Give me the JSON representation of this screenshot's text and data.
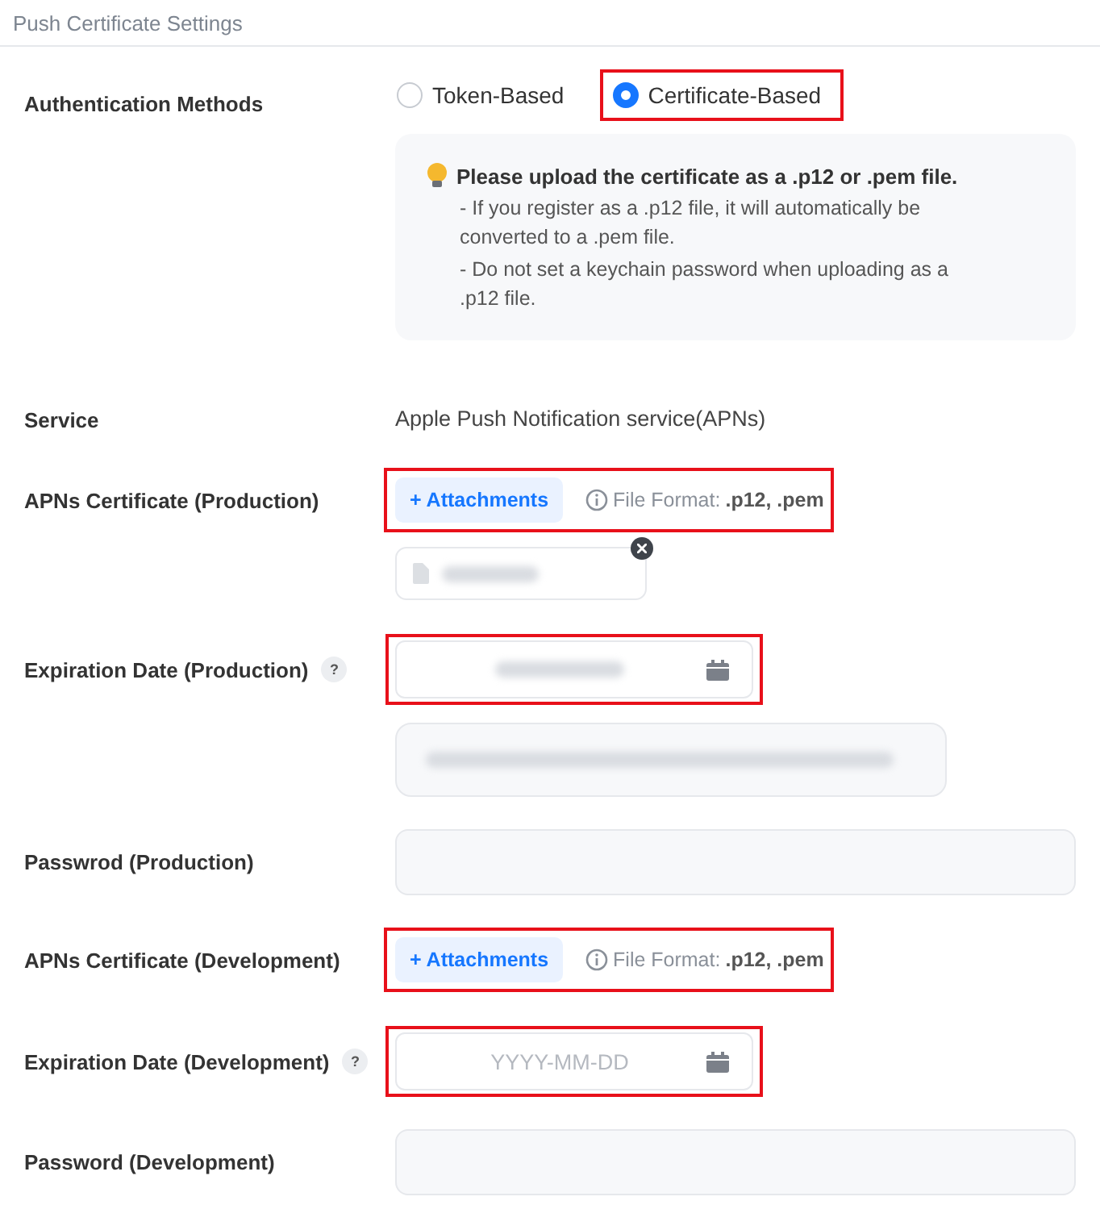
{
  "header": {
    "title": "Push Certificate Settings"
  },
  "rows": [
    {
      "kind": "radio",
      "label": "Authentication Methods",
      "options": [
        {
          "label": "Token-Based",
          "selected": false,
          "highlighted": false
        },
        {
          "label": "Certificate-Based",
          "selected": true,
          "highlighted": true
        }
      ],
      "notice": {
        "title": "Please upload the certificate as a .p12 or .pem file.",
        "lines": [
          "- If you register as a .p12 file, it will automatically be converted to a .pem file.",
          "- Do not set a keychain password when uploading as a .p12 file."
        ]
      }
    },
    {
      "kind": "text",
      "label": "Service",
      "value": "Apple Push Notification service(APNs)"
    },
    {
      "kind": "attachment",
      "label": "APNs Certificate (Production)",
      "button": "+ Attachments",
      "format_label": "File Format:",
      "format_value": ".p12, .pem",
      "highlighted": true,
      "has_file": true
    },
    {
      "kind": "date",
      "label": "Expiration Date (Production)",
      "help": "?",
      "value_hidden": true,
      "highlighted": true,
      "has_details": true
    },
    {
      "kind": "password",
      "label": "Passwrod (Production)"
    },
    {
      "kind": "attachment",
      "label": "APNs Certificate (Development)",
      "button": "+ Attachments",
      "format_label": "File Format:",
      "format_value": ".p12, .pem",
      "highlighted": true,
      "has_file": false
    },
    {
      "kind": "date",
      "label": "Expiration Date (Development)",
      "help": "?",
      "placeholder": "YYYY-MM-DD",
      "value_hidden": false,
      "highlighted": true,
      "has_details": false
    },
    {
      "kind": "password",
      "label": "Password (Development)"
    }
  ]
}
